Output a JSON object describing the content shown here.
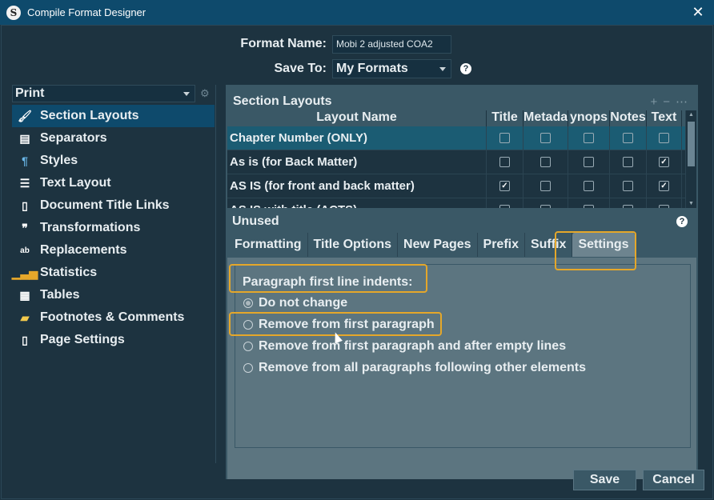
{
  "window": {
    "title": "Compile Format Designer",
    "app_icon_letter": "S"
  },
  "header": {
    "format_name_label": "Format Name:",
    "format_name_value": "Mobi 2 adjusted COA2",
    "save_to_label": "Save To:",
    "save_to_value": "My Formats"
  },
  "sidebar": {
    "dropdown_value": "Print",
    "items": [
      {
        "label": "Section Layouts",
        "icon": "brush-icon",
        "selected": true
      },
      {
        "label": "Separators",
        "icon": "separator-icon"
      },
      {
        "label": "Styles",
        "icon": "styles-icon"
      },
      {
        "label": "Text Layout",
        "icon": "text-layout-icon"
      },
      {
        "label": "Document Title Links",
        "icon": "document-icon"
      },
      {
        "label": "Transformations",
        "icon": "quote-icon"
      },
      {
        "label": "Replacements",
        "icon": "replace-icon"
      },
      {
        "label": "Statistics",
        "icon": "bar-chart-icon"
      },
      {
        "label": "Tables",
        "icon": "table-icon"
      },
      {
        "label": "Footnotes & Comments",
        "icon": "footnote-icon"
      },
      {
        "label": "Page Settings",
        "icon": "page-icon"
      }
    ]
  },
  "section_layouts": {
    "title": "Section Layouts",
    "columns": [
      "Layout Name",
      "Title",
      "Metadat",
      "ynops",
      "Notes",
      "Text"
    ],
    "rows": [
      {
        "name": "Chapter Number (ONLY)",
        "checks": [
          false,
          false,
          false,
          false,
          false
        ]
      },
      {
        "name": "As is (for Back Matter)",
        "checks": [
          false,
          false,
          false,
          false,
          true
        ]
      },
      {
        "name": "AS IS (for front and back matter)",
        "checks": [
          true,
          false,
          false,
          false,
          true
        ]
      },
      {
        "name": "AS IS with title (ACTS)",
        "checks": [
          false,
          false,
          false,
          false,
          false
        ]
      }
    ],
    "unused_label": "Unused"
  },
  "tabs": [
    "Formatting",
    "Title Options",
    "New Pages",
    "Prefix",
    "Suffix",
    "Settings"
  ],
  "settings": {
    "group_label": "Paragraph first line indents:",
    "options": [
      {
        "label": "Do not change",
        "checked": true
      },
      {
        "label": "Remove from first paragraph",
        "checked": false
      },
      {
        "label": "Remove from first paragraph and after empty lines",
        "checked": false
      },
      {
        "label": "Remove from all paragraphs following other elements",
        "checked": false
      }
    ]
  },
  "footer": {
    "save_label": "Save",
    "cancel_label": "Cancel"
  },
  "colors": {
    "titlebar": "#0e4a6c",
    "background": "#1d3340",
    "highlight": "#e5a72a",
    "selected_row": "#1b5c73"
  }
}
